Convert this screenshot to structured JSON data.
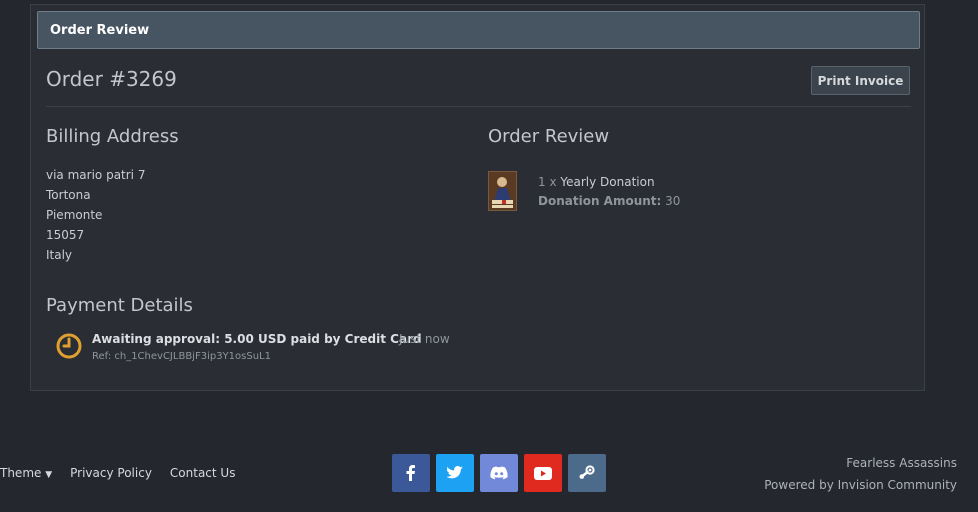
{
  "panel": {
    "header_title": "Order Review",
    "order_title": "Order #3269",
    "print_button": "Print Invoice"
  },
  "billing": {
    "title": "Billing Address",
    "lines": [
      "via mario patri 7",
      "Tortona",
      "Piemonte",
      "15057",
      "Italy"
    ]
  },
  "order_review": {
    "title": "Order Review",
    "item": {
      "qty": "1 x",
      "name": "Yearly Donation",
      "amount_label": "Donation Amount:",
      "amount_value": "30"
    }
  },
  "payment": {
    "title": "Payment Details",
    "status": "Awaiting approval: 5.00 USD paid by Credit Card",
    "time": "Just now",
    "ref": "Ref: ch_1ChevCJLBBjF3ip3Y1osSuL1"
  },
  "footer": {
    "theme": "Theme",
    "privacy": "Privacy Policy",
    "contact": "Contact Us",
    "site_name": "Fearless Assassins",
    "powered_by": "Powered by Invision Community"
  },
  "icons": {
    "facebook": "facebook-icon",
    "twitter": "twitter-icon",
    "discord": "discord-icon",
    "youtube": "youtube-icon",
    "steam": "steam-icon"
  },
  "colors": {
    "facebook": "#3b5998",
    "twitter": "#1da1f2",
    "discord": "#7289da",
    "youtube": "#e02a20",
    "steam": "#4c6b8a",
    "clock": "#e0a030"
  }
}
